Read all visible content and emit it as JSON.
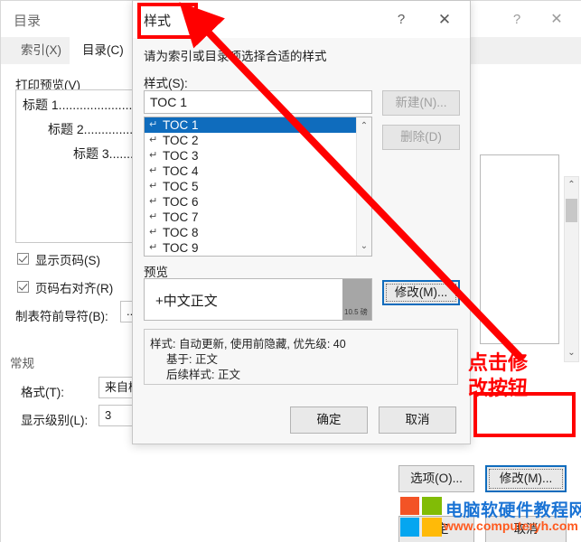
{
  "background_window": {
    "title": "目录",
    "help_icon": "?",
    "close_icon": "✕",
    "tabs": [
      {
        "label": "索引(X)",
        "active": false
      },
      {
        "label": "目录(C)",
        "active": true
      }
    ],
    "print_preview_label": "打印预览(V)",
    "preview_lines": [
      "标题  1...........................................",
      "标题  2.................................",
      "标题  3.........................."
    ],
    "checkboxes": [
      {
        "label": "显示页码(S)",
        "checked": true
      },
      {
        "label": "页码右对齐(R)",
        "checked": true
      }
    ],
    "tab_leader_label": "制表符前导符(B):",
    "tab_leader_value": "......",
    "general_label": "常规",
    "format_label": "格式(T):",
    "format_value": "来自模板",
    "show_levels_label": "显示级别(L):",
    "show_levels_value": "3",
    "buttons": {
      "options": "选项(O)...",
      "modify": "修改(M)...",
      "ok": "确定",
      "cancel": "取消"
    }
  },
  "style_dialog": {
    "title": "样式",
    "help_icon": "?",
    "close_icon": "✕",
    "instruction": "请为索引或目录项选择合适的样式",
    "styles_label": "样式(S):",
    "selected_style": "TOC 1",
    "style_items": [
      {
        "label": "TOC 1",
        "selected": true
      },
      {
        "label": "TOC 2",
        "selected": false
      },
      {
        "label": "TOC 3",
        "selected": false
      },
      {
        "label": "TOC 4",
        "selected": false
      },
      {
        "label": "TOC 5",
        "selected": false
      },
      {
        "label": "TOC 6",
        "selected": false
      },
      {
        "label": "TOC 7",
        "selected": false
      },
      {
        "label": "TOC 8",
        "selected": false
      },
      {
        "label": "TOC 9",
        "selected": false
      }
    ],
    "paragraph_mark": "↵",
    "scroll_up_icon": "⌃",
    "scroll_down_icon": "⌄",
    "new_button": "新建(N)...",
    "delete_button": "删除(D)",
    "preview_label": "预览",
    "preview_font": "+中文正文",
    "preview_font_size": "10.5 磅",
    "modify_button": "修改(M)...",
    "description_lines": [
      "样式: 自动更新, 使用前隐藏, 优先级: 40",
      "基于: 正文",
      "后续样式: 正文"
    ],
    "ok_button": "确定",
    "cancel_button": "取消"
  },
  "annotations": {
    "note_line1": "点击修",
    "note_line2": "改按钮",
    "accent_color": "#ff0000"
  },
  "watermark": {
    "site_name": "电脑软硬件教程网",
    "url": "www.computeryh.com"
  }
}
